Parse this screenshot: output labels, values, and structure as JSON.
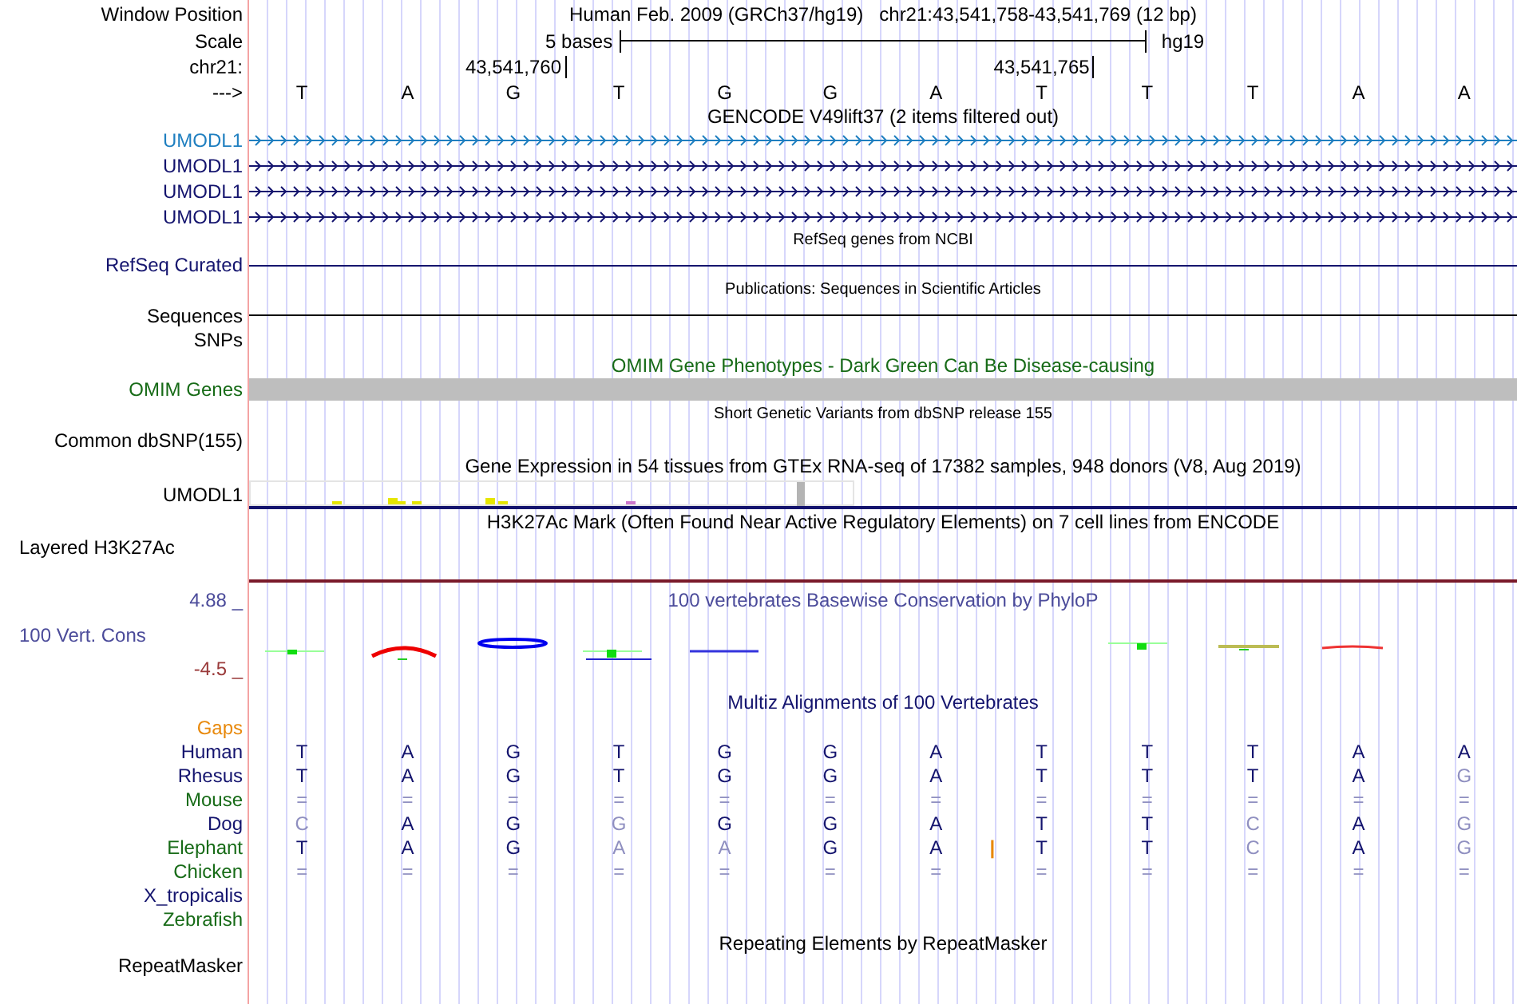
{
  "header": {
    "position_label": "Window Position",
    "assembly": "Human Feb. 2009 (GRCh37/hg19)",
    "position": "chr21:43,541,758-43,541,769 (12 bp)",
    "scale_label": "Scale",
    "scale_text": "5 bases",
    "scale_assembly": "hg19",
    "chrom_label": "chr21:",
    "ticks": [
      "43,541,760",
      "43,541,765"
    ],
    "strand_label": "--->",
    "bases": [
      "T",
      "A",
      "G",
      "T",
      "G",
      "G",
      "A",
      "T",
      "T",
      "T",
      "A",
      "A"
    ]
  },
  "tracks": [
    {
      "kind": "gencode",
      "title": "GENCODE V49lift37 (2 items filtered out)",
      "items": [
        {
          "label": "UMODL1",
          "color": "#1f7fc0"
        },
        {
          "label": "UMODL1",
          "color": "#14146e"
        },
        {
          "label": "UMODL1",
          "color": "#14146e"
        },
        {
          "label": "UMODL1",
          "color": "#14146e"
        }
      ]
    },
    {
      "kind": "refseq",
      "title": "RefSeq genes from NCBI",
      "label": "RefSeq Curated"
    },
    {
      "kind": "publications",
      "title": "Publications: Sequences in Scientific Articles",
      "label": "Sequences"
    },
    {
      "kind": "plain",
      "label": "SNPs"
    },
    {
      "kind": "omim",
      "title": "OMIM Gene Phenotypes - Dark Green Can Be Disease-causing",
      "label": "OMIM Genes"
    },
    {
      "kind": "dbsnp",
      "title": "Short Genetic Variants from dbSNP release 155",
      "label": "Common dbSNP(155)"
    },
    {
      "kind": "gtex",
      "title": "Gene Expression in 54 tissues from GTEx RNA-seq of 17382 samples, 948 donors (V8, Aug 2019)",
      "label": "UMODL1"
    },
    {
      "kind": "h3k27ac",
      "title": "H3K27Ac Mark (Often Found Near Active Regulatory Elements) on 7 cell lines from ENCODE",
      "label": "Layered H3K27Ac"
    },
    {
      "kind": "phylop",
      "title": "100 vertebrates Basewise Conservation by PhyloP",
      "label": "100 Vert. Cons",
      "max": "4.88 _",
      "min": "-4.5 _"
    },
    {
      "kind": "multiz",
      "title": "Multiz Alignments of 100 Vertebrates",
      "species": [
        {
          "name": "Gaps",
          "color": "#e8890c"
        },
        {
          "name": "Human",
          "color": "#14146e",
          "bases": [
            "T",
            "A",
            "G",
            "T",
            "G",
            "G",
            "A",
            "T",
            "T",
            "T",
            "A",
            "A"
          ]
        },
        {
          "name": "Rhesus",
          "color": "#14146e",
          "bases": [
            "T",
            "A",
            "G",
            "T",
            "G",
            "G",
            "A",
            "T",
            "T",
            "T",
            "A",
            "G"
          ]
        },
        {
          "name": "Mouse",
          "color": "#176b17",
          "bases": [
            "=",
            "=",
            "=",
            "=",
            "=",
            "=",
            "=",
            "=",
            "=",
            "=",
            "=",
            "="
          ]
        },
        {
          "name": "Dog",
          "color": "#14146e",
          "bases": [
            "C",
            "A",
            "G",
            "G",
            "G",
            "G",
            "A",
            "T",
            "T",
            "C",
            "A",
            "G"
          ]
        },
        {
          "name": "Elephant",
          "color": "#176b17",
          "bases": [
            "T",
            "A",
            "G",
            "A",
            "A",
            "G",
            "A",
            "|",
            "T",
            "T",
            "C",
            "A",
            "G"
          ]
        },
        {
          "name": "Chicken",
          "color": "#176b17",
          "bases": [
            "=",
            "=",
            "=",
            "=",
            "=",
            "=",
            "=",
            "=",
            "=",
            "=",
            "=",
            "="
          ]
        },
        {
          "name": "X_tropicalis",
          "color": "#14146e"
        },
        {
          "name": "Zebrafish",
          "color": "#176b17"
        }
      ]
    },
    {
      "kind": "repeatmasker",
      "title": "Repeating Elements by RepeatMasker",
      "label": "RepeatMasker"
    }
  ]
}
